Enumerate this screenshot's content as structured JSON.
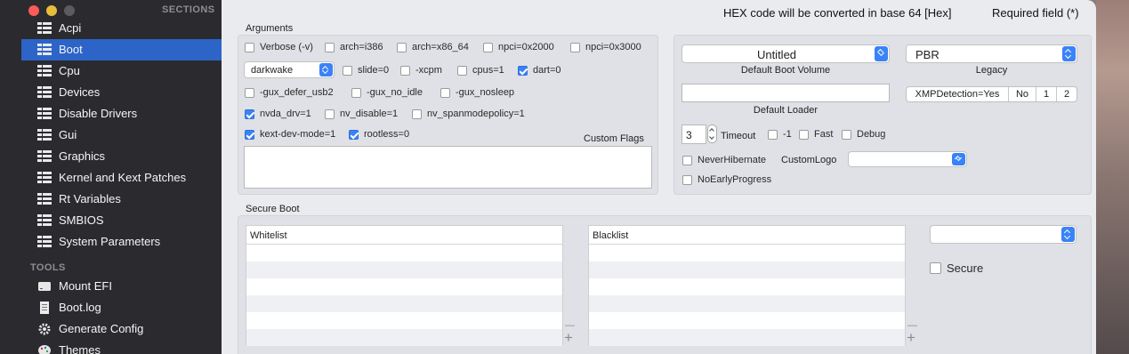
{
  "sidebar": {
    "sections_header": "SECTIONS",
    "sections": [
      {
        "label": "Acpi",
        "icon": "list-icon"
      },
      {
        "label": "Boot",
        "icon": "list-icon",
        "active": true
      },
      {
        "label": "Cpu",
        "icon": "list-icon"
      },
      {
        "label": "Devices",
        "icon": "list-icon"
      },
      {
        "label": "Disable Drivers",
        "icon": "list-icon"
      },
      {
        "label": "Gui",
        "icon": "list-icon"
      },
      {
        "label": "Graphics",
        "icon": "list-icon"
      },
      {
        "label": "Kernel and Kext Patches",
        "icon": "list-icon"
      },
      {
        "label": "Rt Variables",
        "icon": "list-icon"
      },
      {
        "label": "SMBIOS",
        "icon": "list-icon"
      },
      {
        "label": "System Parameters",
        "icon": "list-icon"
      }
    ],
    "tools_header": "TOOLS",
    "tools": [
      {
        "label": "Mount EFI",
        "icon": "drive-icon"
      },
      {
        "label": "Boot.log",
        "icon": "document-icon"
      },
      {
        "label": "Generate Config",
        "icon": "gear-icon"
      },
      {
        "label": "Themes",
        "icon": "palette-icon"
      }
    ]
  },
  "header": {
    "hex_note": "HEX code will be converted in base 64 [Hex]",
    "required_note": "Required field (*)"
  },
  "arguments": {
    "title": "Arguments",
    "row1": [
      {
        "label": "Verbose (-v)",
        "checked": false
      },
      {
        "label": "arch=i386",
        "checked": false
      },
      {
        "label": "arch=x86_64",
        "checked": false
      },
      {
        "label": "npci=0x2000",
        "checked": false
      },
      {
        "label": "npci=0x3000",
        "checked": false
      }
    ],
    "darkwake_value": "darkwake",
    "row2": [
      {
        "label": "slide=0",
        "checked": false
      },
      {
        "label": "-xcpm",
        "checked": false
      },
      {
        "label": "cpus=1",
        "checked": false
      },
      {
        "label": "dart=0",
        "checked": true
      }
    ],
    "row3": [
      {
        "label": "-gux_defer_usb2",
        "checked": false
      },
      {
        "label": "-gux_no_idle",
        "checked": false
      },
      {
        "label": "-gux_nosleep",
        "checked": false
      }
    ],
    "row4": [
      {
        "label": "nvda_drv=1",
        "checked": true
      },
      {
        "label": "nv_disable=1",
        "checked": false
      },
      {
        "label": "nv_spanmodepolicy=1",
        "checked": false
      }
    ],
    "row5": [
      {
        "label": "kext-dev-mode=1",
        "checked": true
      },
      {
        "label": "rootless=0",
        "checked": true
      }
    ],
    "custom_flags_label": "Custom Flags",
    "custom_flags_value": ""
  },
  "boot_settings": {
    "default_volume_value": "Untitled",
    "default_volume_label": "Default Boot Volume",
    "legacy_value": "PBR",
    "legacy_label": "Legacy",
    "default_loader_value": "",
    "default_loader_label": "Default Loader",
    "xmp_segments": [
      "XMPDetection=Yes",
      "No",
      "1",
      "2"
    ],
    "timeout_value": "3",
    "timeout_label": "Timeout",
    "minus_one_label": "-1",
    "fast_label": "Fast",
    "debug_label": "Debug",
    "never_hibernate_label": "NeverHibernate",
    "custom_logo_label": "CustomLogo",
    "custom_logo_value": "",
    "no_early_progress_label": "NoEarlyProgress"
  },
  "secure_boot": {
    "title": "Secure Boot",
    "whitelist_header": "Whitelist",
    "blacklist_header": "Blacklist",
    "policy_value": "",
    "secure_label": "Secure",
    "remove_symbol": "—",
    "add_symbol": "+"
  },
  "colors": {
    "accent": "#3a82f7",
    "sidebar_bg": "#2b2a2f",
    "sidebar_active": "#2c64c8"
  }
}
